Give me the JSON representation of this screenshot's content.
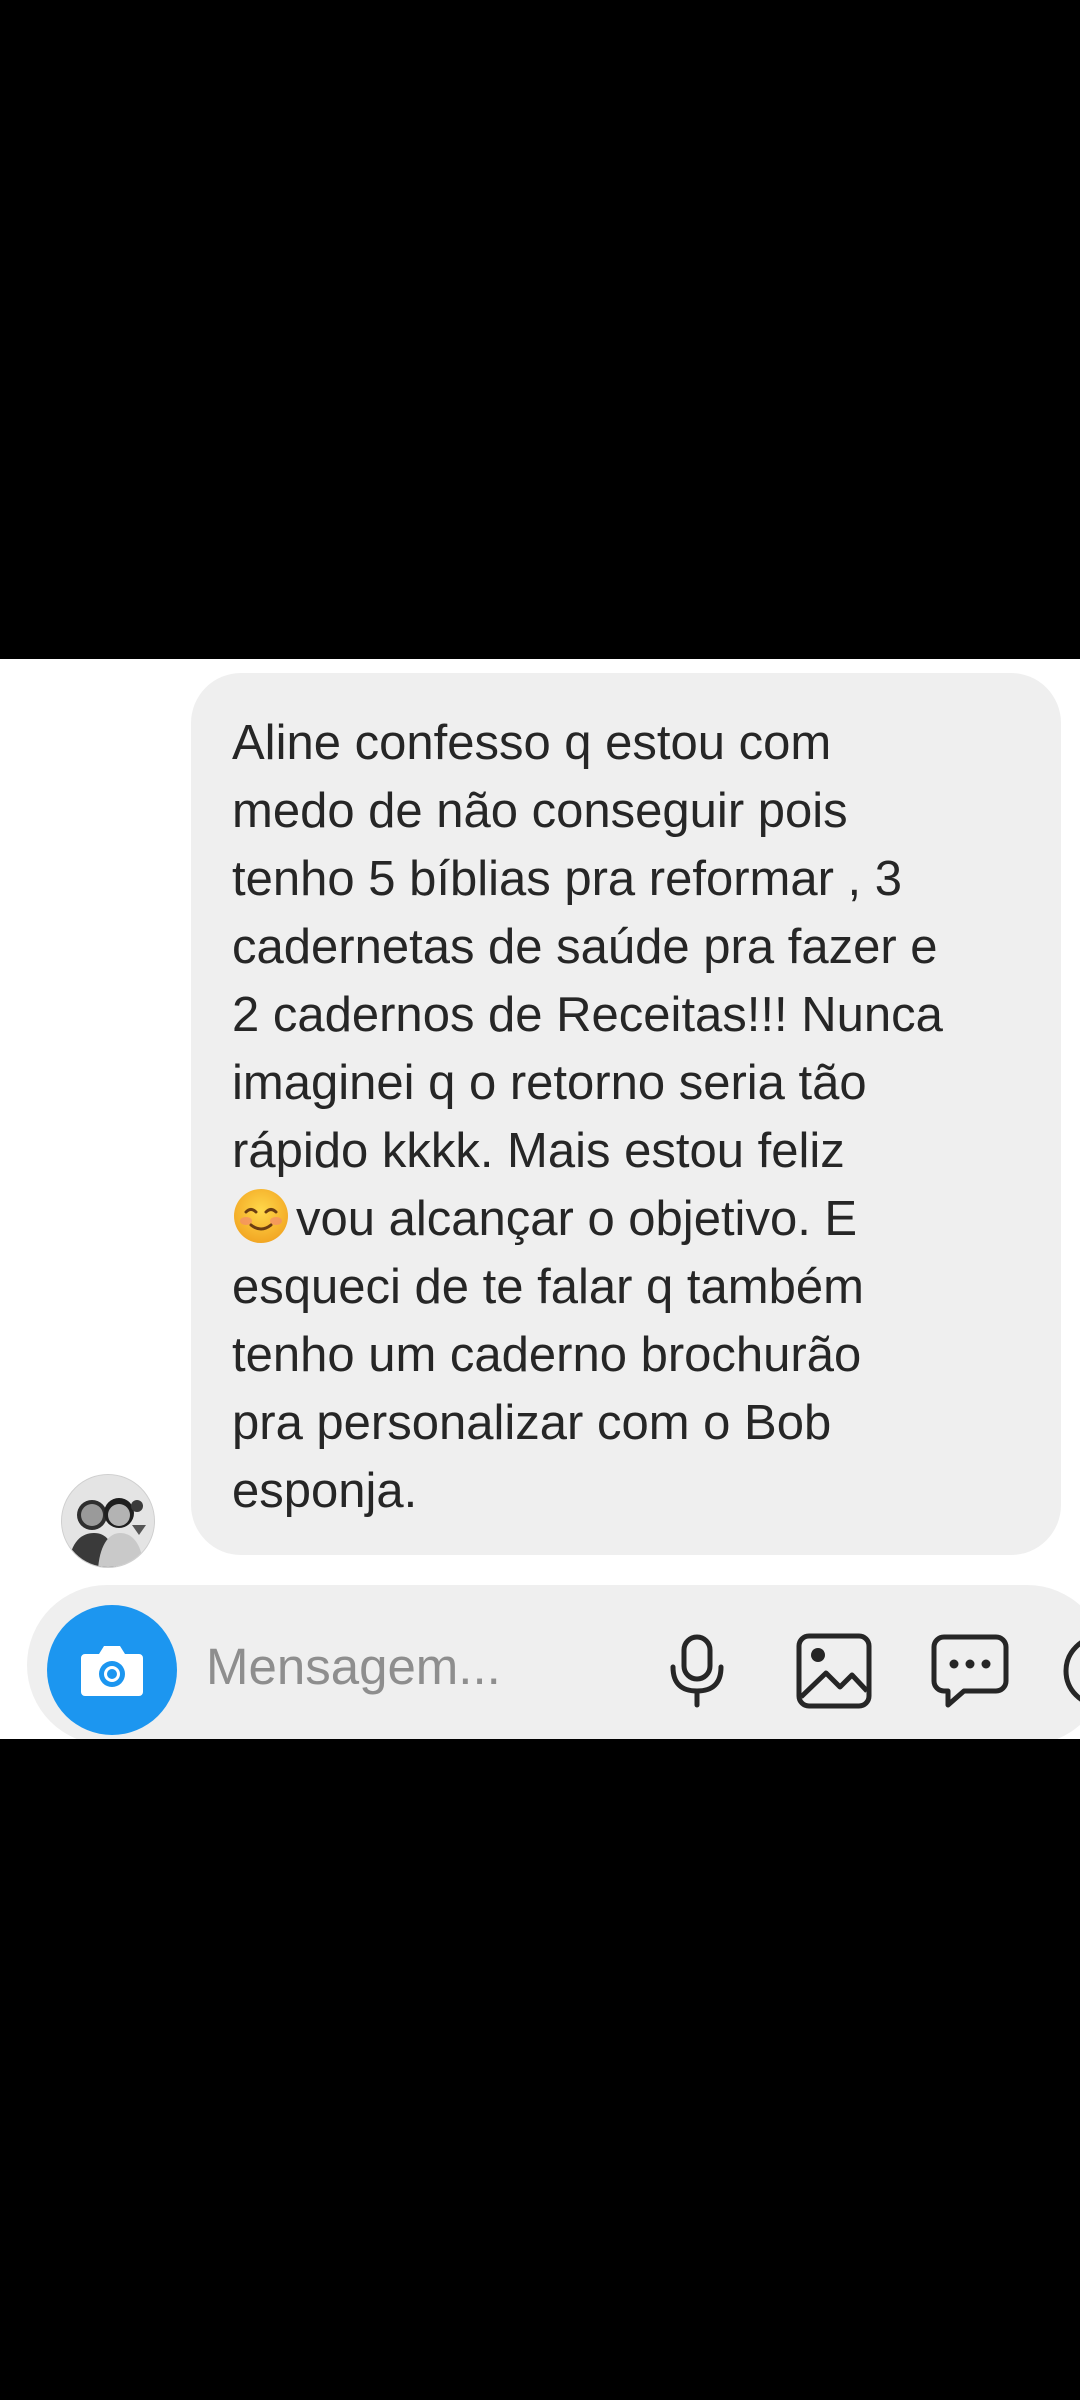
{
  "conversation": {
    "message": {
      "lines": [
        "Aline confesso q estou com",
        "medo de não conseguir pois",
        "tenho 5 bíblias pra reformar , 3",
        "cadernetas de saúde pra fazer e",
        "2 cadernos de Receitas!!! Nunca",
        "imaginei q o retorno seria tão",
        "rápido kkkk. Mais estou feliz"
      ],
      "emoji_icon": "smiling-face-with-smiling-eyes",
      "emoji_line_text": "vou alcançar o objetivo.  E",
      "lines_after": [
        "esqueci de te falar q também",
        "tenho um caderno brochurão",
        "pra personalizar com o Bob",
        "esponja."
      ]
    },
    "sender_avatar_icon": "profile-photo"
  },
  "composer": {
    "placeholder": "Mensagem...",
    "camera_icon": "camera-icon",
    "mic_icon": "microphone-icon",
    "gallery_icon": "gallery-icon",
    "sticker_icon": "chat-bubble-icon",
    "accent_color": "#1c96f0"
  },
  "colors": {
    "background": "#000000",
    "panel": "#ffffff",
    "bubble": "#efefef",
    "text": "#262626",
    "placeholder": "#8e8e8e"
  }
}
